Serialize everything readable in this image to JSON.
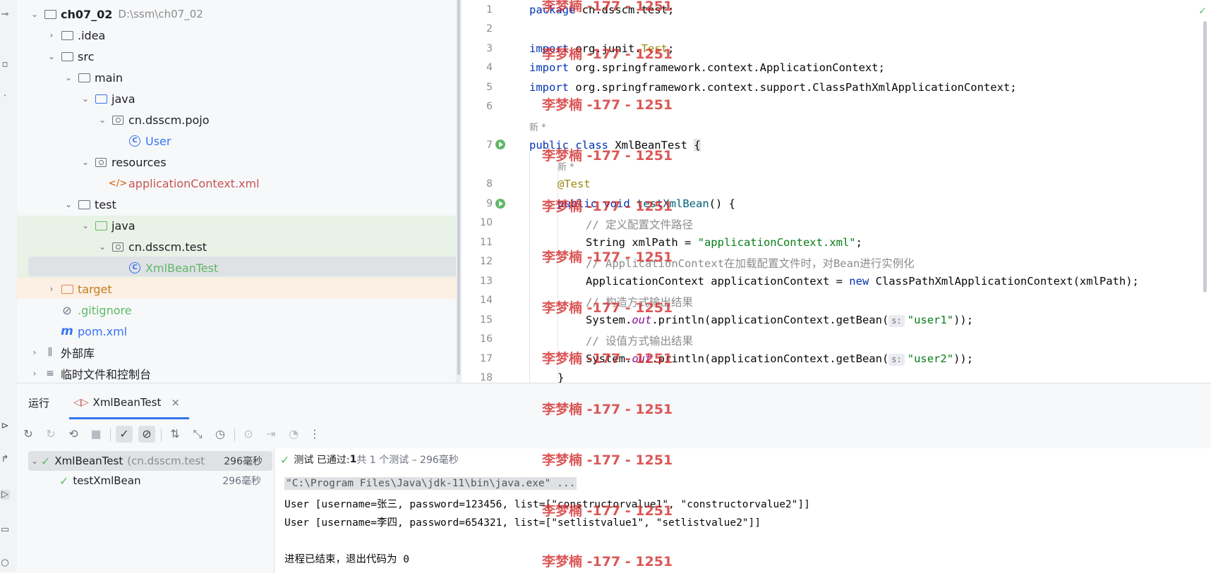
{
  "project_tree": {
    "root": {
      "name": "ch07_02",
      "path": "D:\\ssm\\ch07_02"
    },
    "items": [
      {
        "label": ".idea"
      },
      {
        "label": "src"
      },
      {
        "label": "main"
      },
      {
        "label": "java"
      },
      {
        "label": "cn.dsscm.pojo"
      },
      {
        "label": "User"
      },
      {
        "label": "resources"
      },
      {
        "label": "applicationContext.xml"
      },
      {
        "label": "test"
      },
      {
        "label": "java"
      },
      {
        "label": "cn.dsscm.test"
      },
      {
        "label": "XmlBeanTest"
      },
      {
        "label": "target"
      },
      {
        "label": ".gitignore"
      },
      {
        "label": "pom.xml"
      },
      {
        "label": "外部库"
      },
      {
        "label": "临时文件和控制台"
      }
    ]
  },
  "editor": {
    "line_numbers": [
      "1",
      "2",
      "3",
      "4",
      "5",
      "6",
      "7",
      "8",
      "9",
      "10",
      "11",
      "12",
      "13",
      "14",
      "15",
      "16",
      "17",
      "18"
    ],
    "hints": {
      "new_class": "新 *",
      "new_method": "新 *"
    },
    "code": {
      "l1_kw": "package",
      "l1_rest": " cn.dsscm.test;",
      "l3_kw": "import",
      "l3_rest": " org.junit.",
      "l3_ann": "Test",
      "l3_end": ";",
      "l4_kw": "import",
      "l4_rest": " org.springframework.context.ApplicationContext;",
      "l5_kw": "import",
      "l5_rest": " org.springframework.context.support.ClassPathXmlApplicationContext;",
      "l7_kw": "public class",
      "l7_rest": " XmlBeanTest ",
      "l7_brace": "{",
      "l8_ann": "@Test",
      "l9_kw": "public void",
      "l9_fn": "testXmlBean",
      "l9_rest": "() {",
      "l10": "// 定义配置文件路径",
      "l11_a": "String xmlPath = ",
      "l11_str": "\"applicationContext.xml\"",
      "l11_end": ";",
      "l12": "// ApplicationContext在加载配置文件时，对Bean进行实例化",
      "l13_a": "ApplicationContext applicationContext = ",
      "l13_kw": "new",
      "l13_rest": " ClassPathXmlApplicationContext(xmlPath);",
      "l14": "// 构造方式输出结果",
      "l15_a": "System.",
      "l15_out": "out",
      "l15_b": ".println(applicationContext.getBean(",
      "l15_hint": "s:",
      "l15_str": "\"user1\"",
      "l15_end": "));",
      "l16": "// 设值方式输出结果",
      "l17_a": "System.",
      "l17_out": "out",
      "l17_b": ".println(applicationContext.getBean(",
      "l17_hint": "s:",
      "l17_str": "\"user2\"",
      "l17_end": "));",
      "l18": "}"
    }
  },
  "run_panel": {
    "tab_run": "运行",
    "tab_config": "XmlBeanTest",
    "tests": [
      {
        "name": "XmlBeanTest",
        "detail": "(cn.dsscm.test",
        "duration": "296毫秒"
      },
      {
        "name": "testXmlBean",
        "duration": "296毫秒"
      }
    ],
    "status": {
      "prefix": "测试 已通过: ",
      "passed": "1",
      "suffix": "共 1 个测试 – 296毫秒"
    },
    "console": [
      "\"C:\\Program Files\\Java\\jdk-11\\bin\\java.exe\" ...",
      "User [username=张三, password=123456, list=[\"constructorvalue1\", \"constructorvalue2\"]]",
      "User [username=李四, password=654321, list=[\"setlistvalue1\", \"setlistvalue2\"]]",
      "",
      "进程已结束，退出代码为 0"
    ]
  },
  "watermark": "李梦楠 -177 - 1251",
  "colors": {
    "accent": "#3574f0",
    "success": "#5fb865",
    "keyword": "#0033b3",
    "string": "#067d17",
    "watermark": "#d22828"
  }
}
